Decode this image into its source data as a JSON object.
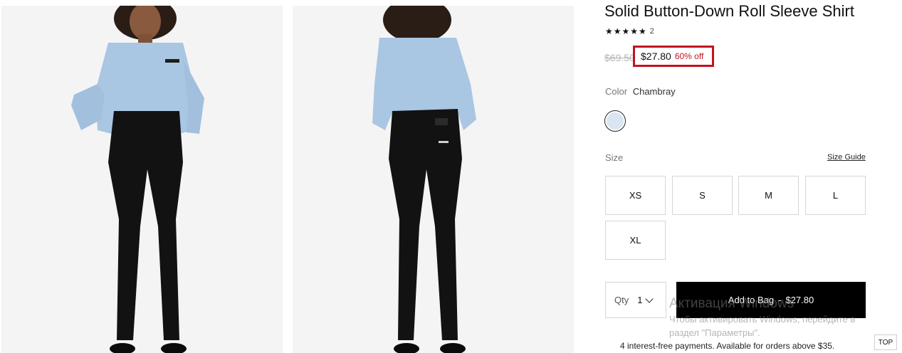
{
  "product": {
    "title": "Solid Button-Down Roll Sleeve Shirt",
    "stars": "★★★★★",
    "review_count": "2",
    "original_price": "$69.50",
    "sale_price": "$27.80",
    "discount": "60% off"
  },
  "color": {
    "label": "Color",
    "value": "Chambray",
    "swatch_color": "#d9e6f2"
  },
  "size": {
    "label": "Size",
    "guide_label": "Size Guide",
    "options": [
      "XS",
      "S",
      "M",
      "L",
      "XL"
    ]
  },
  "quantity": {
    "label": "Qty",
    "value": "1"
  },
  "add_to_bag": {
    "label": "Add to Bag",
    "separator": "-",
    "price": "$27.80"
  },
  "installments": "4 interest-free payments. Available for orders above $35.",
  "watermark": {
    "title": "Активация Windows",
    "line1": "Чтобы активировать Windows, перейдите в",
    "line2": "раздел \"Параметры\"."
  },
  "top_button": "TOP",
  "colors": {
    "sale_red": "#c0151f",
    "button_black": "#000000",
    "chambray": "#d9e6f2"
  }
}
